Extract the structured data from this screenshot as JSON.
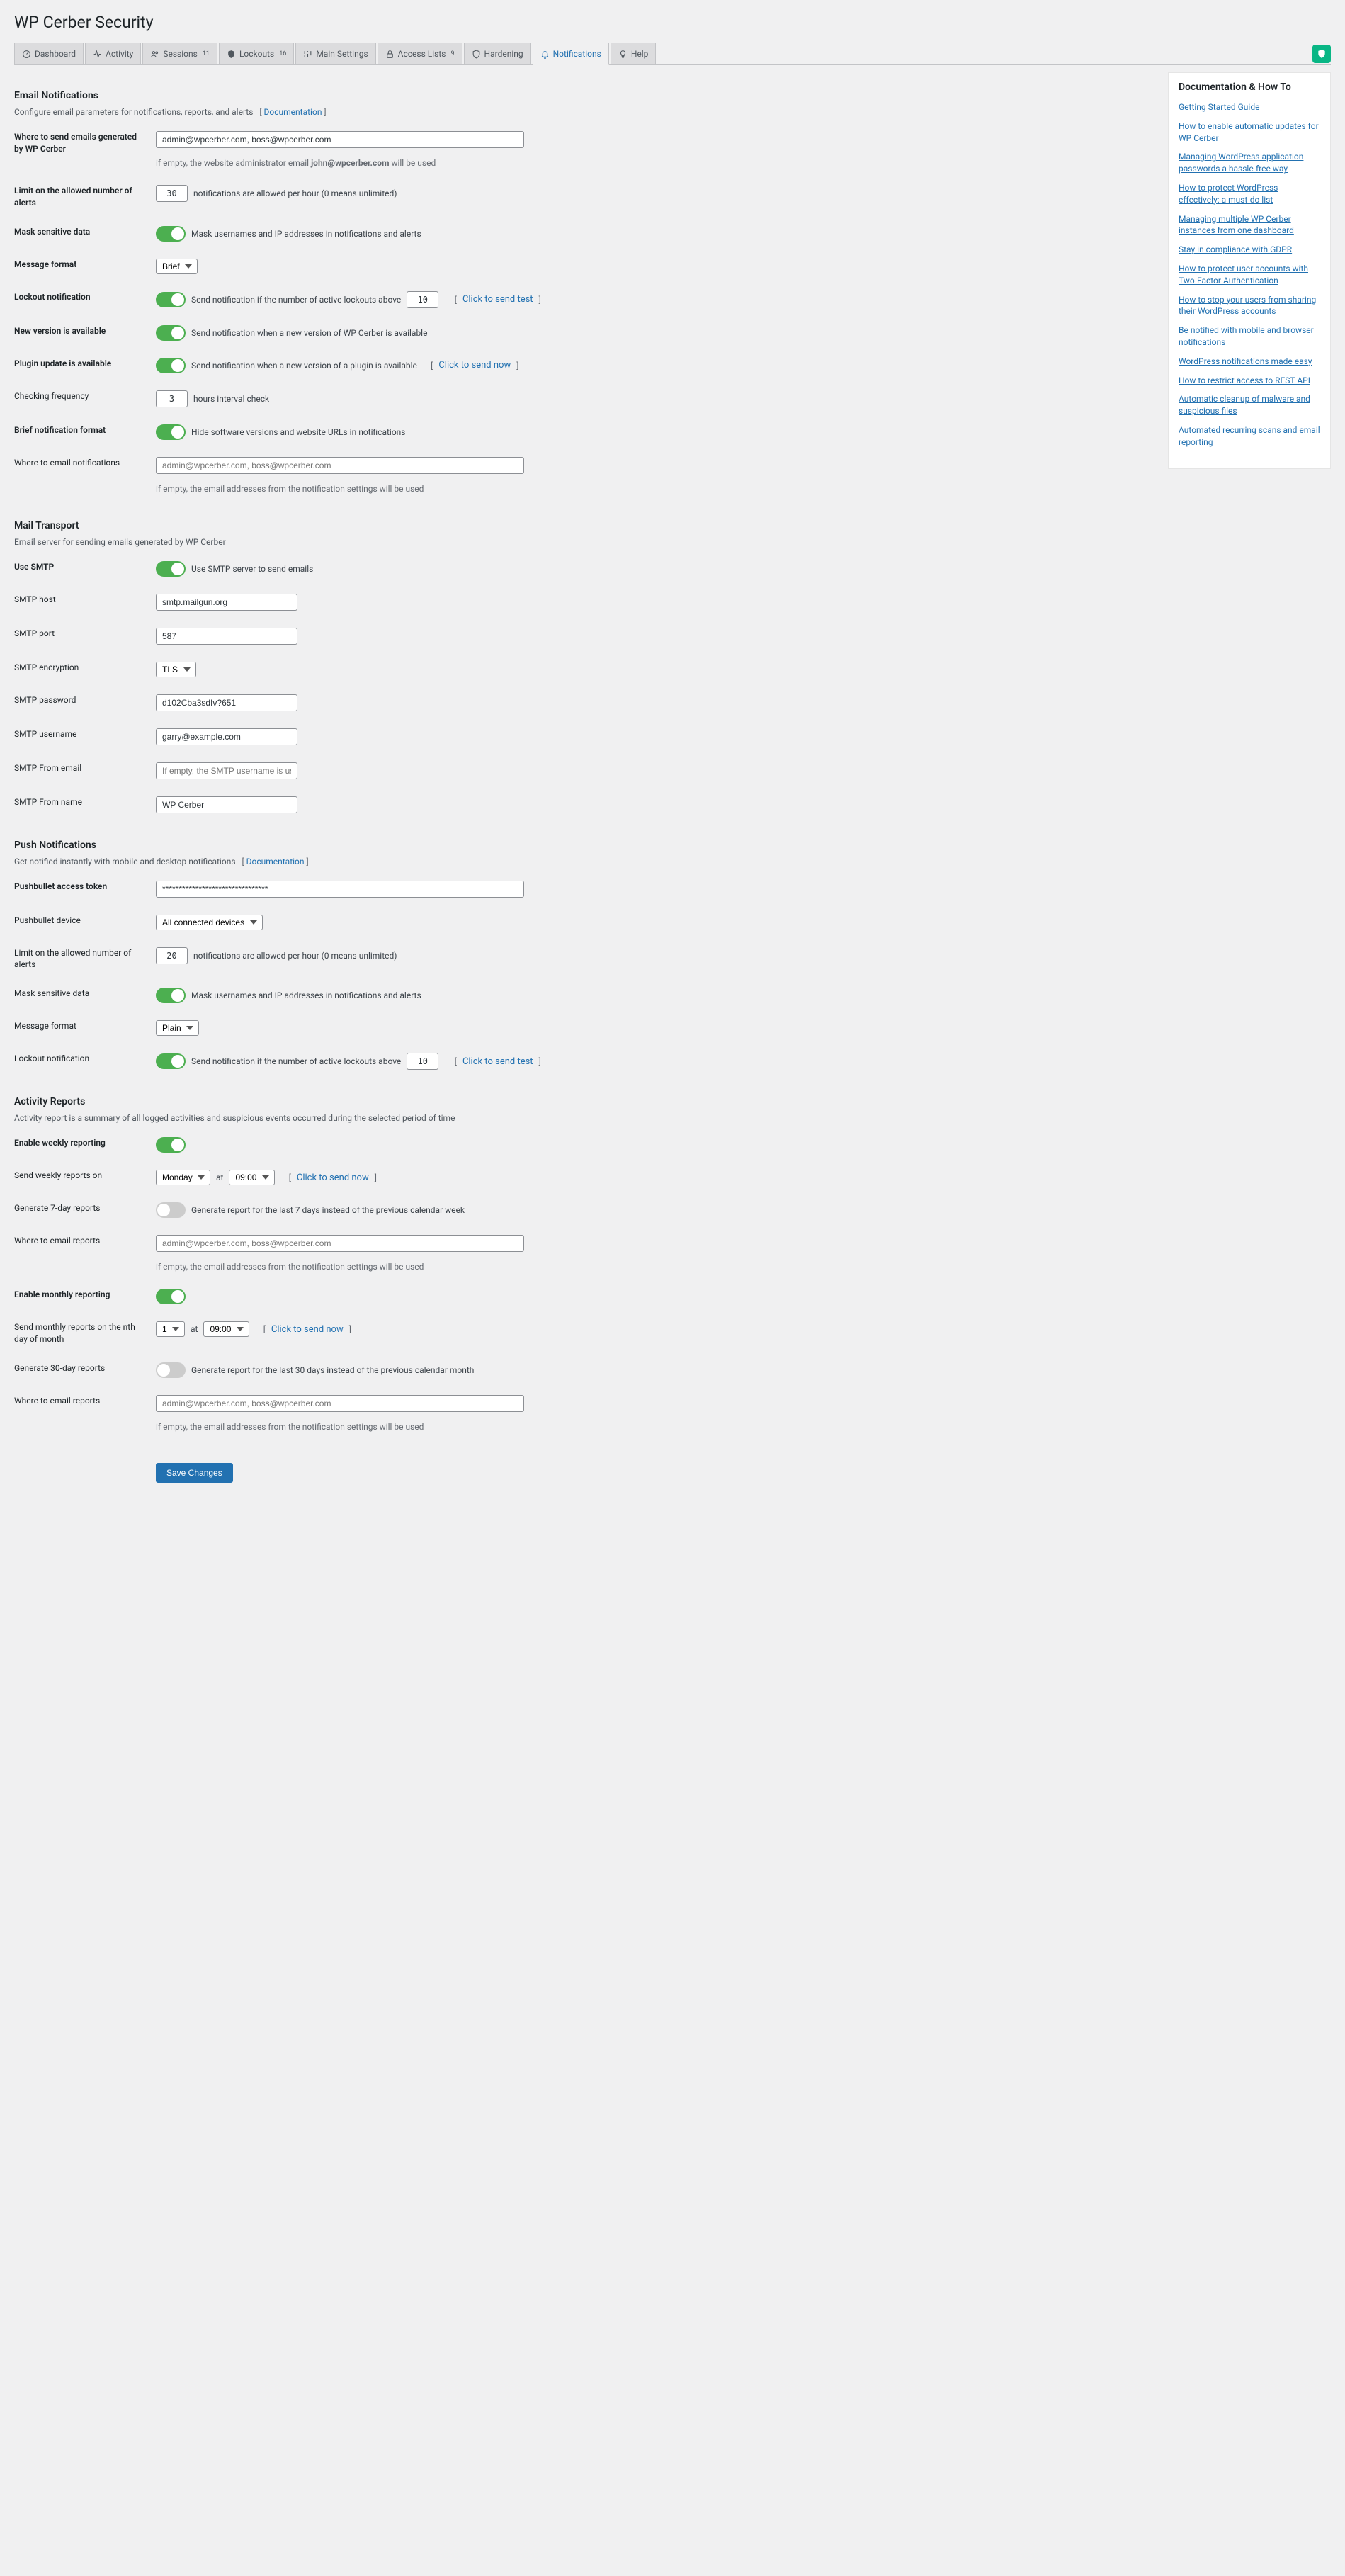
{
  "page_title": "WP Cerber Security",
  "tabs": [
    {
      "label": "Dashboard"
    },
    {
      "label": "Activity"
    },
    {
      "label": "Sessions",
      "sup": "11"
    },
    {
      "label": "Lockouts",
      "sup": "16"
    },
    {
      "label": "Main Settings"
    },
    {
      "label": "Access Lists",
      "sup": "9"
    },
    {
      "label": "Hardening"
    },
    {
      "label": "Notifications",
      "active": true
    },
    {
      "label": "Help"
    }
  ],
  "sidebar": {
    "title": "Documentation & How To",
    "links": [
      "Getting Started Guide",
      "How to enable automatic updates for WP Cerber",
      "Managing WordPress application passwords a hassle-free way",
      "How to protect WordPress effectively: a must-do list",
      "Managing multiple WP Cerber instances from one dashboard",
      "Stay in compliance with GDPR",
      "How to protect user accounts with Two-Factor Authentication",
      "How to stop your users from sharing their WordPress accounts",
      "Be notified with mobile and browser notifications",
      "WordPress notifications made easy",
      "How to restrict access to REST API",
      "Automatic cleanup of malware and suspicious files",
      "Automated recurring scans and email reporting"
    ]
  },
  "email": {
    "heading": "Email Notifications",
    "desc": "Configure email parameters for notifications, reports, and alerts",
    "doc": "Documentation",
    "where_to_send_label": "Where to send emails generated by WP Cerber",
    "where_to_send_value": "admin@wpcerber.com, boss@wpcerber.com",
    "where_to_send_hint_pre": "if empty, the website administrator email ",
    "where_to_send_hint_bold": "john@wpcerber.com",
    "where_to_send_hint_post": " will be used",
    "limit_label": "Limit on the allowed number of alerts",
    "limit_value": "30",
    "limit_hint": "notifications are allowed per hour (0 means unlimited)",
    "mask_label": "Mask sensitive data",
    "mask_hint": "Mask usernames and IP addresses in notifications and alerts",
    "format_label": "Message format",
    "format_value": "Brief",
    "lockout_label": "Lockout notification",
    "lockout_hint": "Send notification if the number of active lockouts above",
    "lockout_value": "10",
    "lockout_test": "Click to send test",
    "newver_label": "New version is available",
    "newver_hint": "Send notification when a new version of WP Cerber is available",
    "plugin_label": "Plugin update is available",
    "plugin_hint": "Send notification when a new version of a plugin is available",
    "plugin_test": "Click to send now",
    "check_label": "Checking frequency",
    "check_value": "3",
    "check_hint": "hours interval check",
    "brief_label": "Brief notification format",
    "brief_hint": "Hide software versions and website URLs in notifications",
    "where_notif_label": "Where to email notifications",
    "where_notif_placeholder": "admin@wpcerber.com, boss@wpcerber.com",
    "where_notif_hint": "if empty, the email addresses from the notification settings will be used"
  },
  "smtp": {
    "heading": "Mail Transport",
    "desc": "Email server for sending emails generated by WP Cerber",
    "use_label": "Use SMTP",
    "use_hint": "Use SMTP server to send emails",
    "host_label": "SMTP host",
    "host_value": "smtp.mailgun.org",
    "port_label": "SMTP port",
    "port_value": "587",
    "enc_label": "SMTP encryption",
    "enc_value": "TLS",
    "pass_label": "SMTP password",
    "pass_value": "d102Cba3sdIv?651",
    "user_label": "SMTP username",
    "user_value": "garry@example.com",
    "from_email_label": "SMTP From email",
    "from_email_placeholder": "If empty, the SMTP username is used",
    "from_name_label": "SMTP From name",
    "from_name_value": "WP Cerber"
  },
  "push": {
    "heading": "Push Notifications",
    "desc": "Get notified instantly with mobile and desktop notifications",
    "doc": "Documentation",
    "token_label": "Pushbullet access token",
    "token_value": "********************************",
    "device_label": "Pushbullet device",
    "device_value": "All connected devices",
    "limit_label": "Limit on the allowed number of alerts",
    "limit_value": "20",
    "limit_hint": "notifications are allowed per hour (0 means unlimited)",
    "mask_label": "Mask sensitive data",
    "mask_hint": "Mask usernames and IP addresses in notifications and alerts",
    "format_label": "Message format",
    "format_value": "Plain",
    "lockout_label": "Lockout notification",
    "lockout_hint": "Send notification if the number of active lockouts above",
    "lockout_value": "10",
    "lockout_test": "Click to send test"
  },
  "reports": {
    "heading": "Activity Reports",
    "desc": "Activity report is a summary of all logged activities and suspicious events occurred during the selected period of time",
    "weekly_label": "Enable weekly reporting",
    "weekly_on_label": "Send weekly reports on",
    "weekly_day": "Monday",
    "at": "at",
    "weekly_time": "09:00",
    "weekly_send": "Click to send now",
    "gen7_label": "Generate 7-day reports",
    "gen7_hint": "Generate report for the last 7 days instead of the previous calendar week",
    "where_label": "Where to email reports",
    "where_placeholder": "admin@wpcerber.com, boss@wpcerber.com",
    "where_hint": "if empty, the email addresses from the notification settings will be used",
    "monthly_label": "Enable monthly reporting",
    "monthly_on_label": "Send monthly reports on the nth day of month",
    "monthly_day": "1",
    "monthly_time": "09:00",
    "monthly_send": "Click to send now",
    "gen30_label": "Generate 30-day reports",
    "gen30_hint": "Generate report for the last 30 days instead of the previous calendar month"
  },
  "save": "Save Changes"
}
